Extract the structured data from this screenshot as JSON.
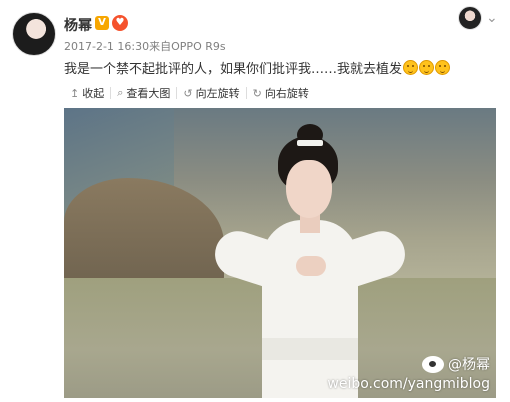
{
  "post": {
    "username": "杨幂",
    "vip_badge": "V",
    "member_badge": "♥",
    "date": "2017-2-1 16:30",
    "source_prefix": "来自",
    "source": "OPPO R9s",
    "text": "我是一个禁不起批评的人，如果你们批评我……我就去植发"
  },
  "toolbar": {
    "collapse_label": "收起",
    "view_large_label": "查看大图",
    "rotate_left_label": "向左旋转",
    "rotate_right_label": "向右旋转"
  },
  "watermark": {
    "handle": "@杨幂",
    "url": "weibo.com/yangmiblog"
  },
  "icons": [
    "avatar",
    "vip-badge-icon",
    "member-icon",
    "chevron-down-icon",
    "collapse-icon",
    "zoom-icon",
    "rotate-left-icon",
    "rotate-right-icon",
    "emoji-icon",
    "weibo-logo-icon"
  ],
  "colors": {
    "vip": "#f7a600",
    "member": "#f5522d",
    "meta": "#808080"
  }
}
